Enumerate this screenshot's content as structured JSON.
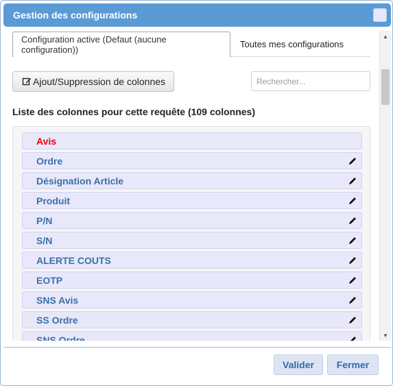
{
  "dialog": {
    "title": "Gestion des configurations"
  },
  "tabs": [
    {
      "label": "Configuration active (Defaut (aucune configuration))",
      "active": true
    },
    {
      "label": "Toutes mes configurations",
      "active": false
    }
  ],
  "toolbar": {
    "columns_button_label": "Ajout/Suppression de colonnes",
    "search_placeholder": "Rechercher..."
  },
  "list": {
    "heading": "Liste des colonnes pour cette requête (109 colonnes)",
    "items": [
      {
        "label": "Avis",
        "color": "#e8000b",
        "editable": false
      },
      {
        "label": "Ordre",
        "editable": true
      },
      {
        "label": "Désignation Article",
        "editable": true
      },
      {
        "label": "Produit",
        "editable": true
      },
      {
        "label": "P/N",
        "editable": true
      },
      {
        "label": "S/N",
        "editable": true
      },
      {
        "label": "ALERTE COUTS",
        "editable": true
      },
      {
        "label": "EOTP",
        "editable": true
      },
      {
        "label": "SNS Avis",
        "editable": true
      },
      {
        "label": "SS Ordre",
        "editable": true
      },
      {
        "label": "SNS Ordre",
        "editable": true
      }
    ]
  },
  "footer": {
    "ok_label": "Valider",
    "close_label": "Fermer"
  },
  "colors": {
    "titlebar": "#5b9bd5",
    "item_text": "#3a6fa8",
    "item_bg": "#e8e8fa"
  }
}
